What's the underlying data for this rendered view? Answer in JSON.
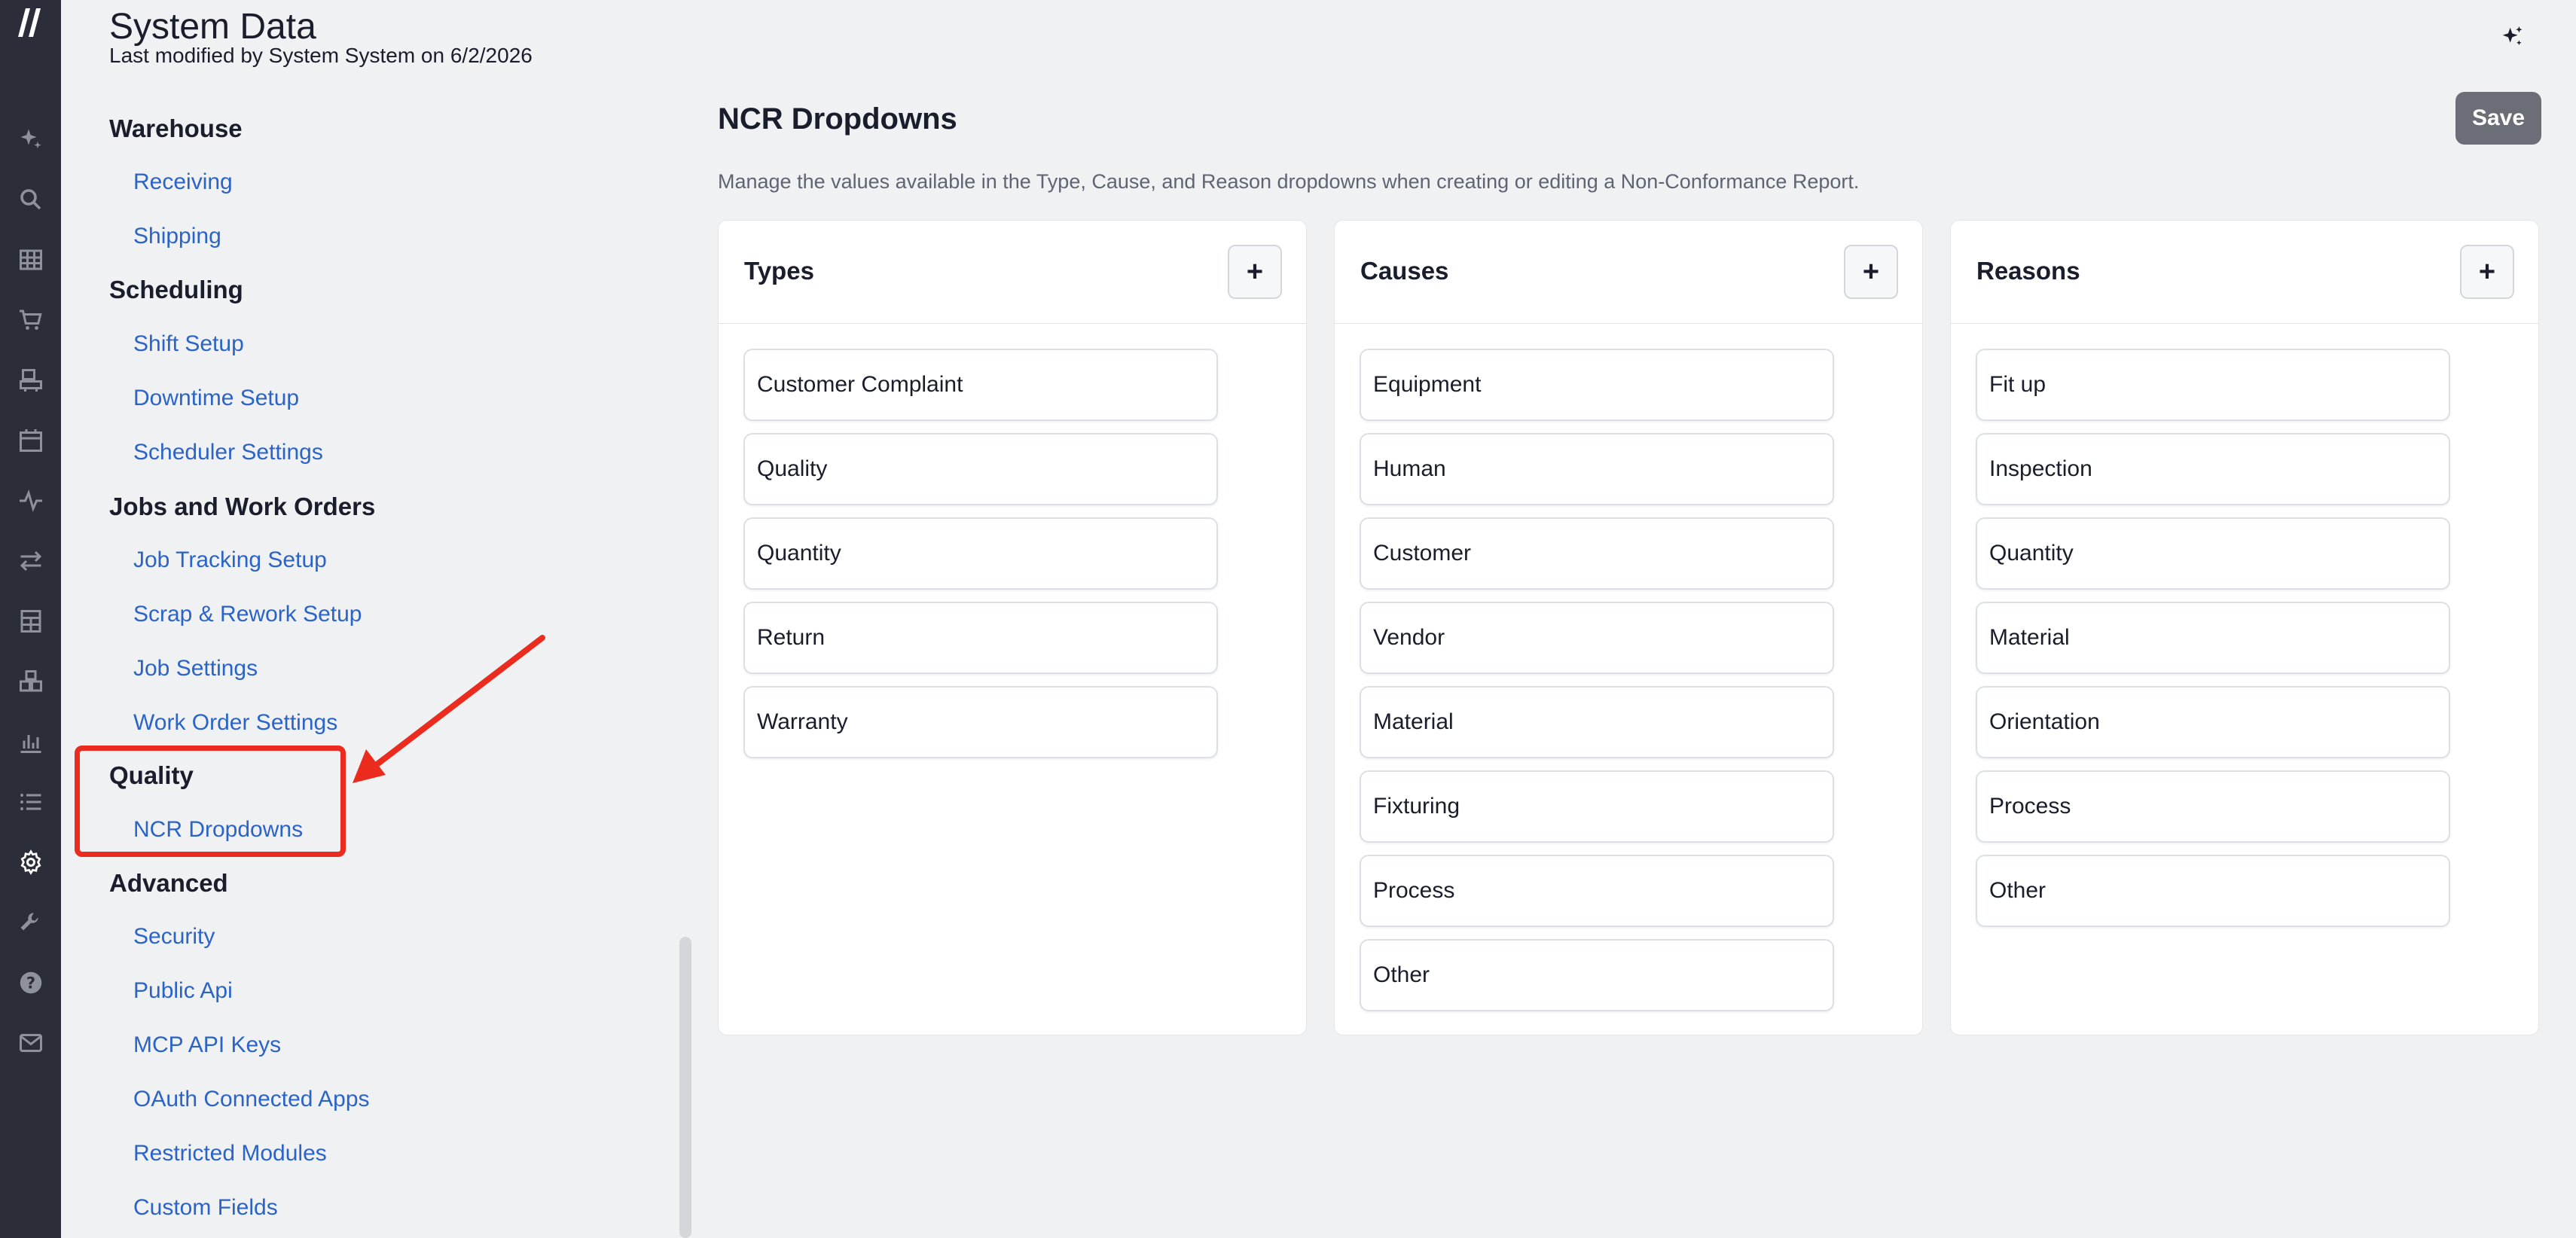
{
  "header": {
    "title": "System Data",
    "subtitle": "Last modified by System System on 6/2/2026"
  },
  "rail": {
    "icons": [
      "logo-icon",
      "sparkle-icon",
      "search-icon",
      "grid-icon",
      "cart-icon",
      "machine-icon",
      "calendar-icon",
      "activity-icon",
      "transfer-icon",
      "calculator-icon",
      "boxes-icon",
      "bar-chart-icon",
      "list-icon",
      "gear-icon",
      "wrench-icon",
      "help-icon",
      "mail-icon"
    ]
  },
  "nav": {
    "groups": [
      {
        "label": "Warehouse",
        "links": [
          "Receiving",
          "Shipping"
        ]
      },
      {
        "label": "Scheduling",
        "links": [
          "Shift Setup",
          "Downtime Setup",
          "Scheduler Settings"
        ]
      },
      {
        "label": "Jobs and Work Orders",
        "links": [
          "Job Tracking Setup",
          "Scrap & Rework Setup",
          "Job Settings",
          "Work Order Settings"
        ]
      },
      {
        "label": "Quality",
        "links": [
          "NCR Dropdowns"
        ]
      },
      {
        "label": "Advanced",
        "links": [
          "Security",
          "Public Api",
          "MCP API Keys",
          "OAuth Connected Apps",
          "Restricted Modules",
          "Custom Fields"
        ]
      }
    ]
  },
  "main": {
    "title": "NCR Dropdowns",
    "description": "Manage the values available in the Type, Cause, and Reason dropdowns when creating or editing a Non-Conformance Report.",
    "save_label": "Save",
    "add_symbol": "+",
    "cards": [
      {
        "title": "Types",
        "items": [
          "Customer Complaint",
          "Quality",
          "Quantity",
          "Return",
          "Warranty"
        ]
      },
      {
        "title": "Causes",
        "items": [
          "Equipment",
          "Human",
          "Customer",
          "Vendor",
          "Material",
          "Fixturing",
          "Process",
          "Other"
        ]
      },
      {
        "title": "Reasons",
        "items": [
          "Fit up",
          "Inspection",
          "Quantity",
          "Material",
          "Orientation",
          "Process",
          "Other"
        ]
      }
    ]
  },
  "colors": {
    "rail_bg": "#2b2e38",
    "link": "#2b63c6",
    "highlight": "#ec2b1f",
    "save_bg": "#6b6e76",
    "page_bg": "#f0f1f3"
  }
}
